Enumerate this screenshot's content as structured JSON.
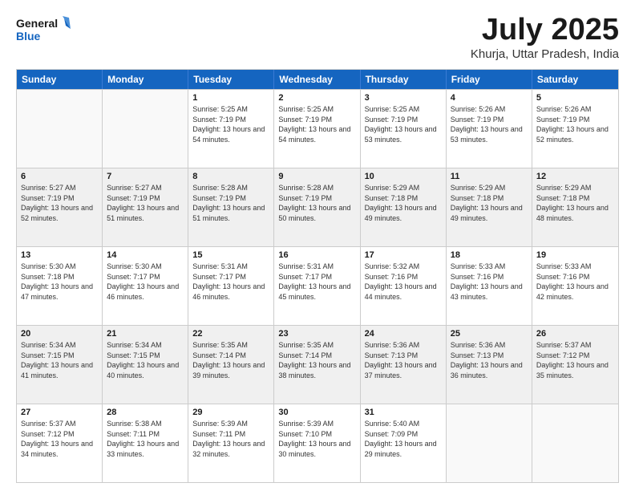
{
  "header": {
    "logo_line1": "General",
    "logo_line2": "Blue",
    "month": "July 2025",
    "location": "Khurja, Uttar Pradesh, India"
  },
  "weekdays": [
    "Sunday",
    "Monday",
    "Tuesday",
    "Wednesday",
    "Thursday",
    "Friday",
    "Saturday"
  ],
  "rows": [
    [
      {
        "day": "",
        "sunrise": "",
        "sunset": "",
        "daylight": "",
        "shaded": false,
        "empty": true
      },
      {
        "day": "",
        "sunrise": "",
        "sunset": "",
        "daylight": "",
        "shaded": false,
        "empty": true
      },
      {
        "day": "1",
        "sunrise": "Sunrise: 5:25 AM",
        "sunset": "Sunset: 7:19 PM",
        "daylight": "Daylight: 13 hours and 54 minutes.",
        "shaded": false,
        "empty": false
      },
      {
        "day": "2",
        "sunrise": "Sunrise: 5:25 AM",
        "sunset": "Sunset: 7:19 PM",
        "daylight": "Daylight: 13 hours and 54 minutes.",
        "shaded": false,
        "empty": false
      },
      {
        "day": "3",
        "sunrise": "Sunrise: 5:25 AM",
        "sunset": "Sunset: 7:19 PM",
        "daylight": "Daylight: 13 hours and 53 minutes.",
        "shaded": false,
        "empty": false
      },
      {
        "day": "4",
        "sunrise": "Sunrise: 5:26 AM",
        "sunset": "Sunset: 7:19 PM",
        "daylight": "Daylight: 13 hours and 53 minutes.",
        "shaded": false,
        "empty": false
      },
      {
        "day": "5",
        "sunrise": "Sunrise: 5:26 AM",
        "sunset": "Sunset: 7:19 PM",
        "daylight": "Daylight: 13 hours and 52 minutes.",
        "shaded": false,
        "empty": false
      }
    ],
    [
      {
        "day": "6",
        "sunrise": "Sunrise: 5:27 AM",
        "sunset": "Sunset: 7:19 PM",
        "daylight": "Daylight: 13 hours and 52 minutes.",
        "shaded": true,
        "empty": false
      },
      {
        "day": "7",
        "sunrise": "Sunrise: 5:27 AM",
        "sunset": "Sunset: 7:19 PM",
        "daylight": "Daylight: 13 hours and 51 minutes.",
        "shaded": true,
        "empty": false
      },
      {
        "day": "8",
        "sunrise": "Sunrise: 5:28 AM",
        "sunset": "Sunset: 7:19 PM",
        "daylight": "Daylight: 13 hours and 51 minutes.",
        "shaded": true,
        "empty": false
      },
      {
        "day": "9",
        "sunrise": "Sunrise: 5:28 AM",
        "sunset": "Sunset: 7:19 PM",
        "daylight": "Daylight: 13 hours and 50 minutes.",
        "shaded": true,
        "empty": false
      },
      {
        "day": "10",
        "sunrise": "Sunrise: 5:29 AM",
        "sunset": "Sunset: 7:18 PM",
        "daylight": "Daylight: 13 hours and 49 minutes.",
        "shaded": true,
        "empty": false
      },
      {
        "day": "11",
        "sunrise": "Sunrise: 5:29 AM",
        "sunset": "Sunset: 7:18 PM",
        "daylight": "Daylight: 13 hours and 49 minutes.",
        "shaded": true,
        "empty": false
      },
      {
        "day": "12",
        "sunrise": "Sunrise: 5:29 AM",
        "sunset": "Sunset: 7:18 PM",
        "daylight": "Daylight: 13 hours and 48 minutes.",
        "shaded": true,
        "empty": false
      }
    ],
    [
      {
        "day": "13",
        "sunrise": "Sunrise: 5:30 AM",
        "sunset": "Sunset: 7:18 PM",
        "daylight": "Daylight: 13 hours and 47 minutes.",
        "shaded": false,
        "empty": false
      },
      {
        "day": "14",
        "sunrise": "Sunrise: 5:30 AM",
        "sunset": "Sunset: 7:17 PM",
        "daylight": "Daylight: 13 hours and 46 minutes.",
        "shaded": false,
        "empty": false
      },
      {
        "day": "15",
        "sunrise": "Sunrise: 5:31 AM",
        "sunset": "Sunset: 7:17 PM",
        "daylight": "Daylight: 13 hours and 46 minutes.",
        "shaded": false,
        "empty": false
      },
      {
        "day": "16",
        "sunrise": "Sunrise: 5:31 AM",
        "sunset": "Sunset: 7:17 PM",
        "daylight": "Daylight: 13 hours and 45 minutes.",
        "shaded": false,
        "empty": false
      },
      {
        "day": "17",
        "sunrise": "Sunrise: 5:32 AM",
        "sunset": "Sunset: 7:16 PM",
        "daylight": "Daylight: 13 hours and 44 minutes.",
        "shaded": false,
        "empty": false
      },
      {
        "day": "18",
        "sunrise": "Sunrise: 5:33 AM",
        "sunset": "Sunset: 7:16 PM",
        "daylight": "Daylight: 13 hours and 43 minutes.",
        "shaded": false,
        "empty": false
      },
      {
        "day": "19",
        "sunrise": "Sunrise: 5:33 AM",
        "sunset": "Sunset: 7:16 PM",
        "daylight": "Daylight: 13 hours and 42 minutes.",
        "shaded": false,
        "empty": false
      }
    ],
    [
      {
        "day": "20",
        "sunrise": "Sunrise: 5:34 AM",
        "sunset": "Sunset: 7:15 PM",
        "daylight": "Daylight: 13 hours and 41 minutes.",
        "shaded": true,
        "empty": false
      },
      {
        "day": "21",
        "sunrise": "Sunrise: 5:34 AM",
        "sunset": "Sunset: 7:15 PM",
        "daylight": "Daylight: 13 hours and 40 minutes.",
        "shaded": true,
        "empty": false
      },
      {
        "day": "22",
        "sunrise": "Sunrise: 5:35 AM",
        "sunset": "Sunset: 7:14 PM",
        "daylight": "Daylight: 13 hours and 39 minutes.",
        "shaded": true,
        "empty": false
      },
      {
        "day": "23",
        "sunrise": "Sunrise: 5:35 AM",
        "sunset": "Sunset: 7:14 PM",
        "daylight": "Daylight: 13 hours and 38 minutes.",
        "shaded": true,
        "empty": false
      },
      {
        "day": "24",
        "sunrise": "Sunrise: 5:36 AM",
        "sunset": "Sunset: 7:13 PM",
        "daylight": "Daylight: 13 hours and 37 minutes.",
        "shaded": true,
        "empty": false
      },
      {
        "day": "25",
        "sunrise": "Sunrise: 5:36 AM",
        "sunset": "Sunset: 7:13 PM",
        "daylight": "Daylight: 13 hours and 36 minutes.",
        "shaded": true,
        "empty": false
      },
      {
        "day": "26",
        "sunrise": "Sunrise: 5:37 AM",
        "sunset": "Sunset: 7:12 PM",
        "daylight": "Daylight: 13 hours and 35 minutes.",
        "shaded": true,
        "empty": false
      }
    ],
    [
      {
        "day": "27",
        "sunrise": "Sunrise: 5:37 AM",
        "sunset": "Sunset: 7:12 PM",
        "daylight": "Daylight: 13 hours and 34 minutes.",
        "shaded": false,
        "empty": false
      },
      {
        "day": "28",
        "sunrise": "Sunrise: 5:38 AM",
        "sunset": "Sunset: 7:11 PM",
        "daylight": "Daylight: 13 hours and 33 minutes.",
        "shaded": false,
        "empty": false
      },
      {
        "day": "29",
        "sunrise": "Sunrise: 5:39 AM",
        "sunset": "Sunset: 7:11 PM",
        "daylight": "Daylight: 13 hours and 32 minutes.",
        "shaded": false,
        "empty": false
      },
      {
        "day": "30",
        "sunrise": "Sunrise: 5:39 AM",
        "sunset": "Sunset: 7:10 PM",
        "daylight": "Daylight: 13 hours and 30 minutes.",
        "shaded": false,
        "empty": false
      },
      {
        "day": "31",
        "sunrise": "Sunrise: 5:40 AM",
        "sunset": "Sunset: 7:09 PM",
        "daylight": "Daylight: 13 hours and 29 minutes.",
        "shaded": false,
        "empty": false
      },
      {
        "day": "",
        "sunrise": "",
        "sunset": "",
        "daylight": "",
        "shaded": false,
        "empty": true
      },
      {
        "day": "",
        "sunrise": "",
        "sunset": "",
        "daylight": "",
        "shaded": false,
        "empty": true
      }
    ]
  ]
}
